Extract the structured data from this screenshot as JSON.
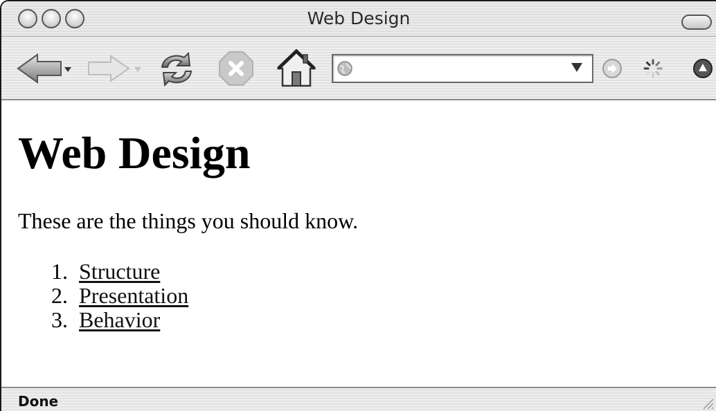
{
  "window": {
    "title": "Web Design",
    "traffic_lights": [
      "close-button",
      "minimize-button",
      "zoom-button"
    ]
  },
  "toolbar": {
    "icons": [
      "back-arrow-icon",
      "forward-arrow-icon",
      "reload-icon",
      "stop-icon",
      "home-icon",
      "globe-icon",
      "go-icon",
      "loading-spinner-icon",
      "activity-icon"
    ],
    "url_value": ""
  },
  "page": {
    "heading": "Web Design",
    "intro": "These are the things you should know.",
    "list": [
      {
        "number": "1.",
        "label": "Structure"
      },
      {
        "number": "2.",
        "label": "Presentation"
      },
      {
        "number": "3.",
        "label": "Behavior"
      }
    ]
  },
  "status": {
    "text": "Done"
  }
}
